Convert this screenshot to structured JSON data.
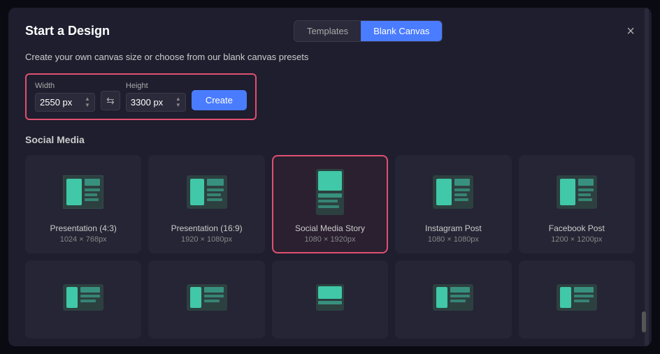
{
  "modal": {
    "title": "Start a Design",
    "close_label": "×"
  },
  "tabs": [
    {
      "id": "templates",
      "label": "Templates",
      "active": false
    },
    {
      "id": "blank-canvas",
      "label": "Blank Canvas",
      "active": true
    }
  ],
  "description": "Create your own canvas size or choose from our blank canvas presets",
  "dimensions": {
    "width_label": "Width",
    "height_label": "Height",
    "width_value": "2550 px",
    "height_value": "3300 px",
    "swap_icon": "⇆",
    "create_label": "Create"
  },
  "social_media": {
    "section_title": "Social Media",
    "presets": [
      {
        "name": "Presentation (4:3)",
        "dims": "1024 × 768px",
        "type": "landscape",
        "selected": false
      },
      {
        "name": "Presentation (16:9)",
        "dims": "1920 × 1080px",
        "type": "landscape",
        "selected": false
      },
      {
        "name": "Social Media Story",
        "dims": "1080 × 1920px",
        "type": "portrait",
        "selected": true
      },
      {
        "name": "Instagram Post",
        "dims": "1080 × 1080px",
        "type": "square",
        "selected": false
      },
      {
        "name": "Facebook Post",
        "dims": "1200 × 1200px",
        "type": "square",
        "selected": false
      }
    ]
  },
  "second_row_presets": [
    {
      "name": "",
      "dims": "",
      "type": "landscape2"
    },
    {
      "name": "",
      "dims": "",
      "type": "landscape2"
    },
    {
      "name": "",
      "dims": "",
      "type": "portrait2"
    },
    {
      "name": "",
      "dims": "",
      "type": "square2"
    },
    {
      "name": "",
      "dims": "",
      "type": "landscape2"
    }
  ]
}
